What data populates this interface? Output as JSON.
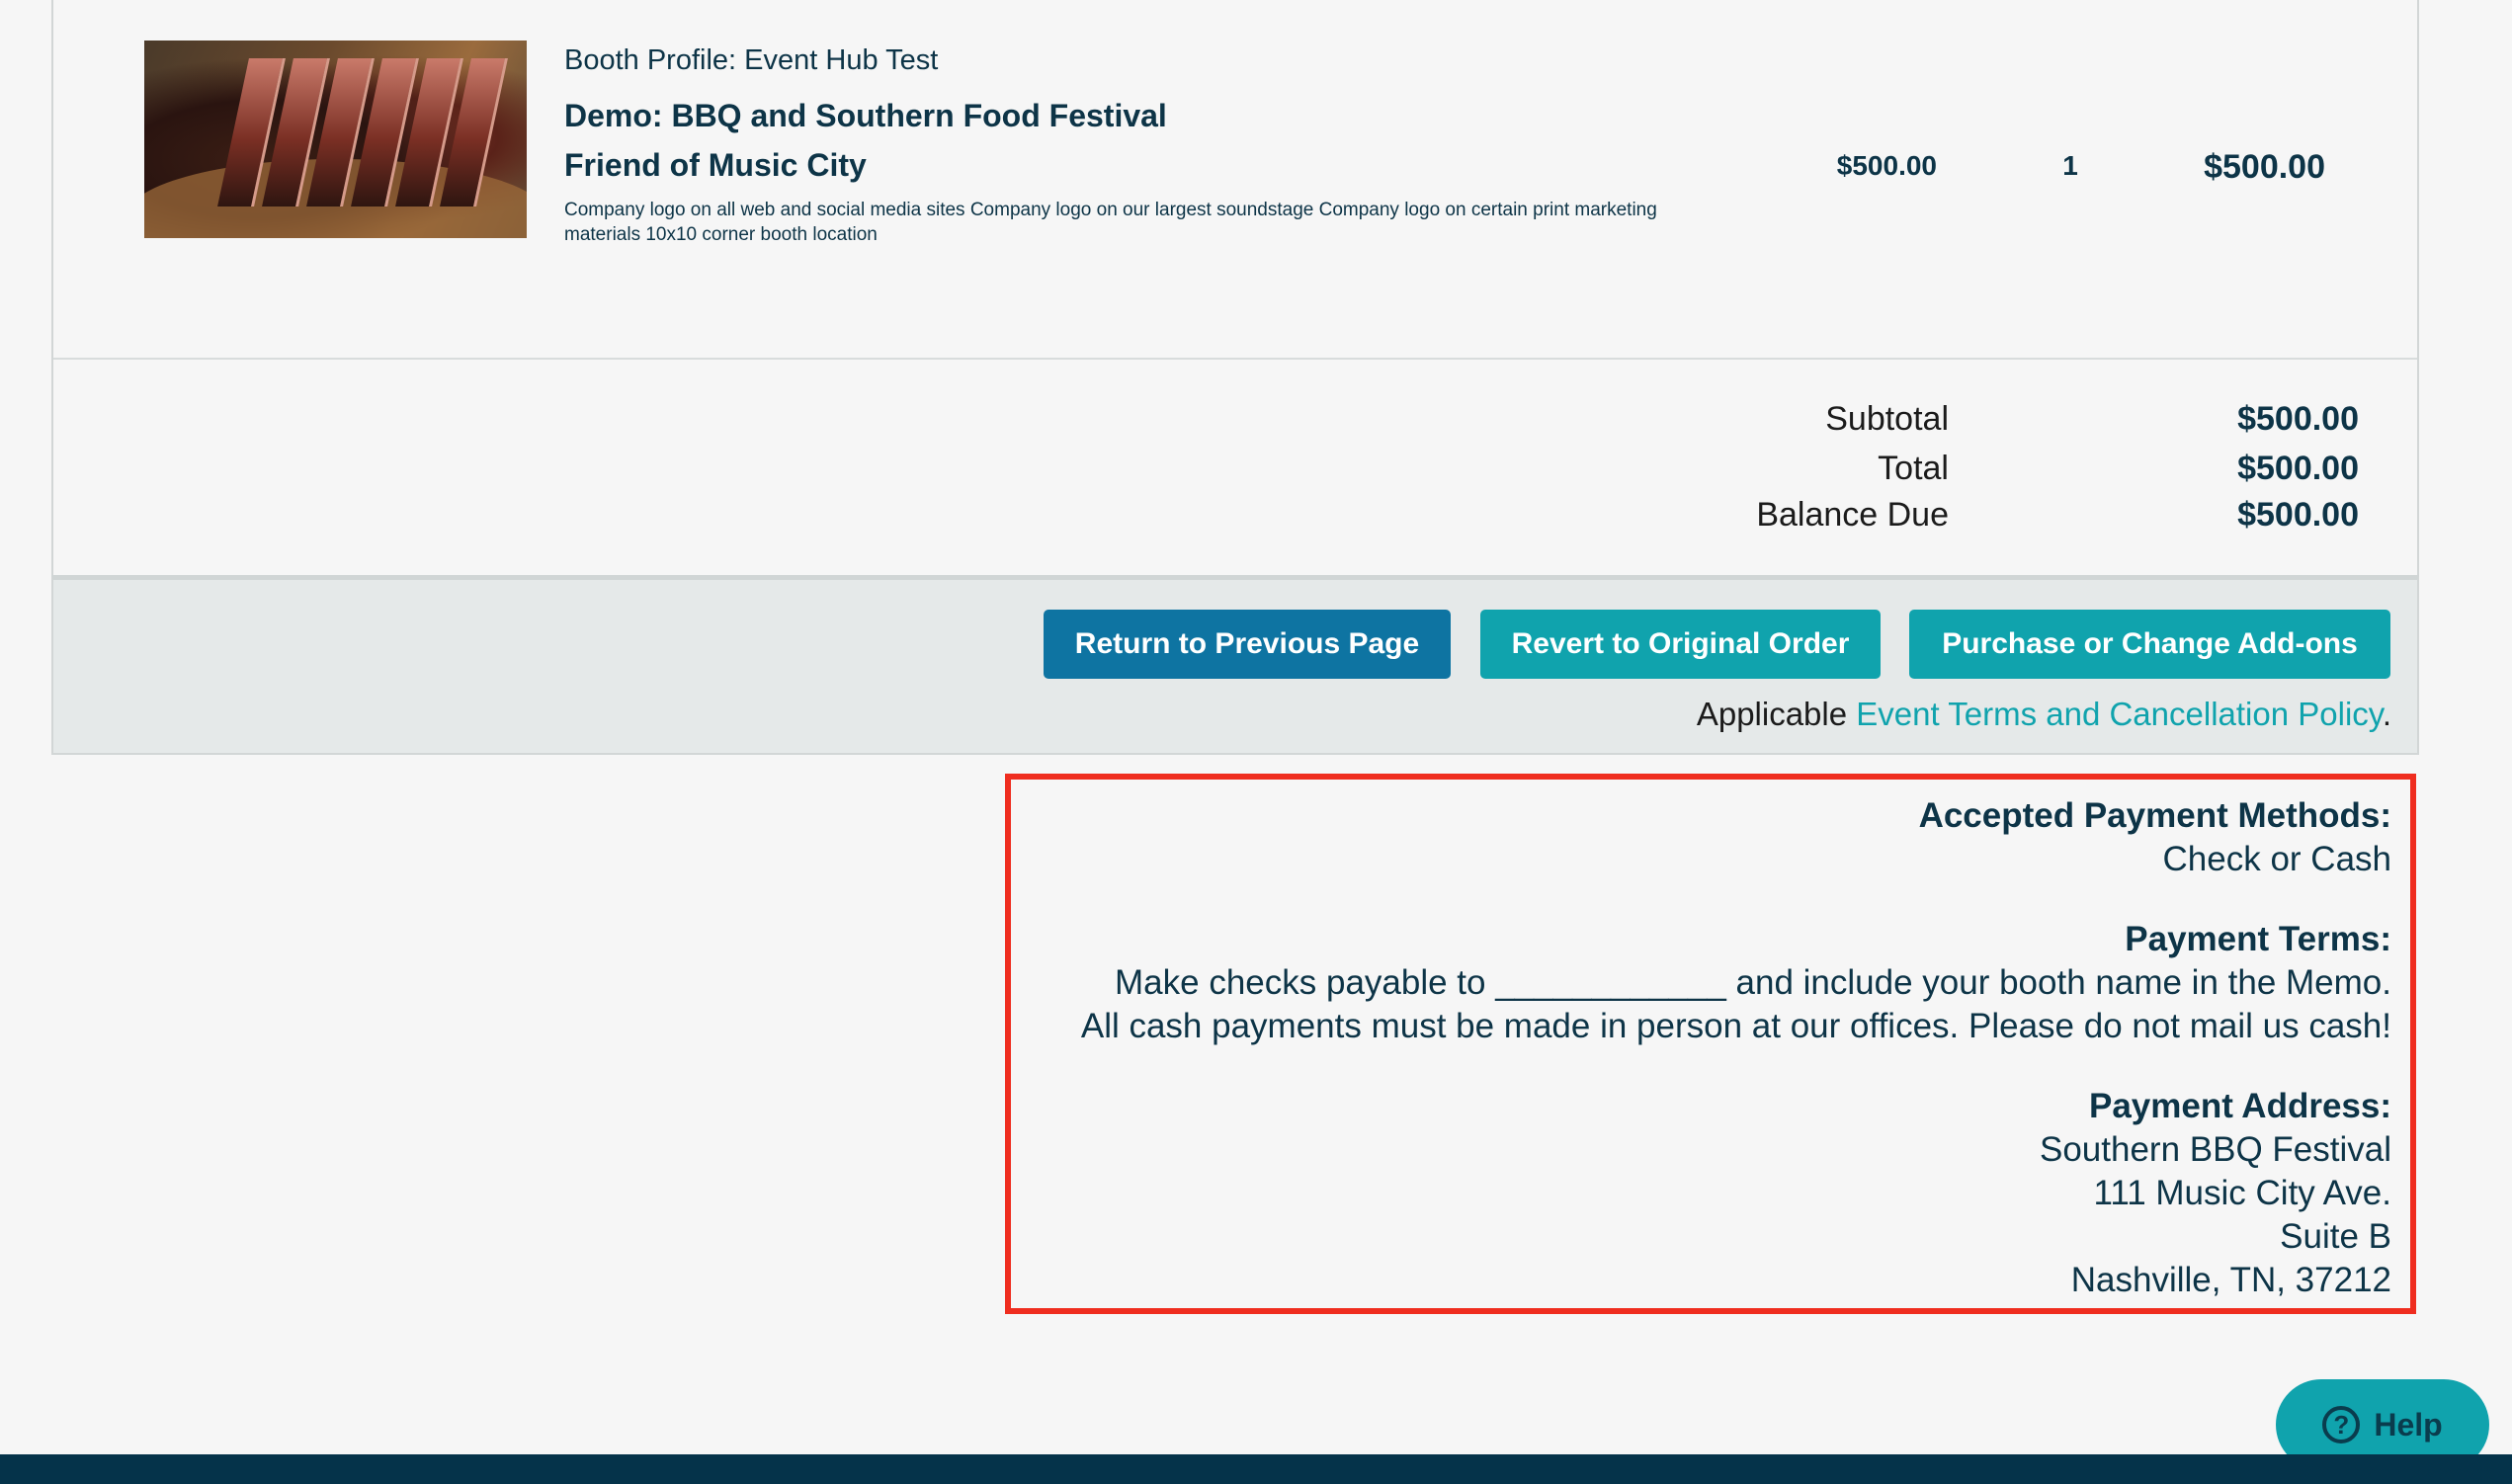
{
  "line_item": {
    "image_alt": "Sliced smoked brisket on a wooden board",
    "booth_profile": "Booth Profile: Event Hub Test",
    "event_name": "Demo: BBQ and Southern Food Festival",
    "package_name": "Friend of Music City",
    "description": "Company logo on all web and social media sites Company logo on our largest soundstage Company logo on certain print marketing materials 10x10 corner booth location",
    "unit_price": "$500.00",
    "quantity": "1",
    "line_total": "$500.00"
  },
  "totals": {
    "subtotal_label": "Subtotal",
    "subtotal_value": "$500.00",
    "total_label": "Total",
    "total_value": "$500.00",
    "balance_label": "Balance Due",
    "balance_value": "$500.00"
  },
  "actions": {
    "return_label": "Return to Previous Page",
    "revert_label": "Revert to Original Order",
    "purchase_label": "Purchase or Change Add-ons",
    "terms_prefix": "Applicable ",
    "terms_link": "Event Terms and Cancellation Policy",
    "terms_suffix": "."
  },
  "payment": {
    "methods_heading": "Accepted Payment Methods:",
    "methods_value": "Check or Cash",
    "terms_heading": "Payment Terms:",
    "terms_line1": "Make checks payable to ____________ and include your booth name in the Memo.",
    "terms_line2": "All cash payments must be made in person at our offices. Please do not mail us cash!",
    "address_heading": "Payment Address:",
    "address_line1": "Southern BBQ Festival",
    "address_line2": "111 Music City Ave.",
    "address_line3": "Suite B",
    "address_line4": "Nashville, TN, 37212"
  },
  "help": {
    "label": "Help",
    "icon": "question-circle-icon"
  },
  "colors": {
    "primary_button": "#0e74a2",
    "teal_button": "#10a3ad",
    "text": "#0d3447",
    "highlight_border": "#ef2d1f",
    "footer": "#05334a"
  }
}
